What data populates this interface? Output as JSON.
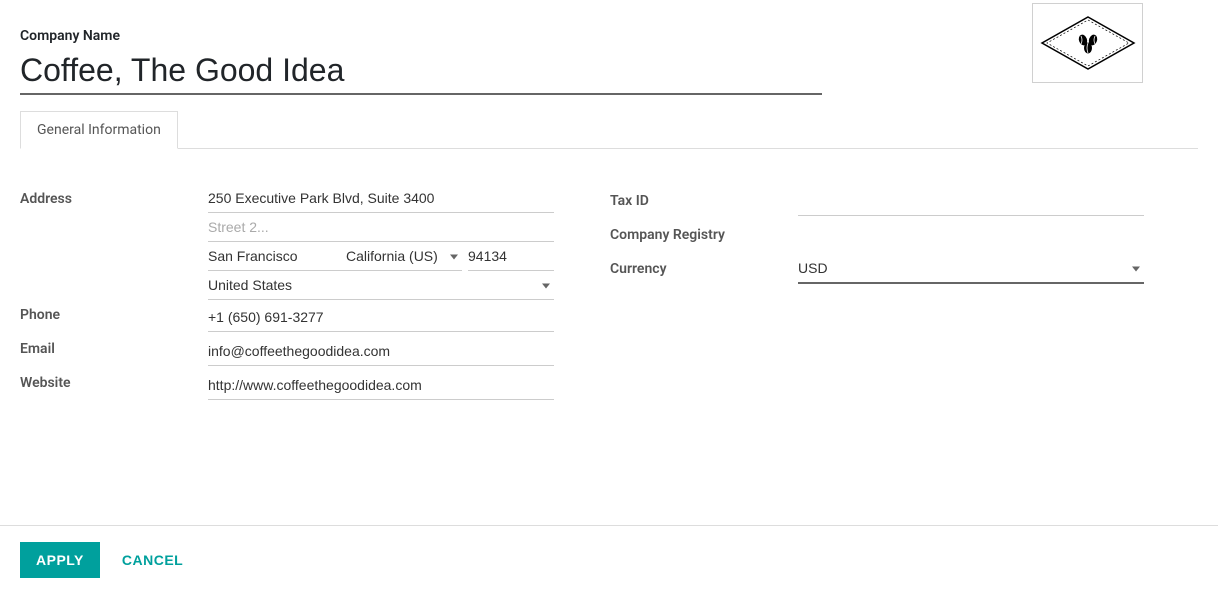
{
  "header": {
    "company_label": "Company Name",
    "company_name": "Coffee, The Good Idea"
  },
  "tabs": {
    "general_info": "General Information"
  },
  "form": {
    "address_label": "Address",
    "street1": "250 Executive Park Blvd, Suite 3400",
    "street2_placeholder": "Street 2...",
    "street2": "",
    "city": "San Francisco",
    "state": "California (US)",
    "zip": "94134",
    "country": "United States",
    "phone_label": "Phone",
    "phone": "+1 (650) 691-3277",
    "email_label": "Email",
    "email": "info@coffeethegoodidea.com",
    "website_label": "Website",
    "website": "http://www.coffeethegoodidea.com",
    "taxid_label": "Tax ID",
    "taxid": "",
    "registry_label": "Company Registry",
    "registry": "",
    "currency_label": "Currency",
    "currency": "USD"
  },
  "footer": {
    "apply": "APPLY",
    "cancel": "CANCEL"
  }
}
